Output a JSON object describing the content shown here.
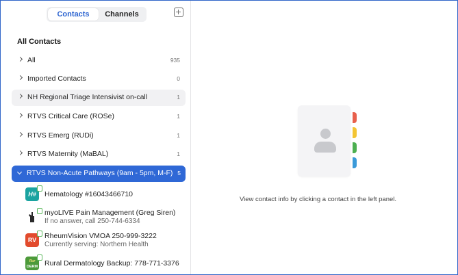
{
  "tabs": {
    "contacts": "Contacts",
    "channels": "Channels"
  },
  "heading": "All Contacts",
  "groups": [
    {
      "label": "All",
      "count": "935"
    },
    {
      "label": "Imported Contacts",
      "count": "0"
    },
    {
      "label": "NH Regional Triage Intensivist on-call",
      "count": "1"
    },
    {
      "label": "RTVS Critical Care (ROSe)",
      "count": "1"
    },
    {
      "label": "RTVS Emerg (RUDi)",
      "count": "1"
    },
    {
      "label": "RTVS Maternity (MaBAL)",
      "count": "1"
    },
    {
      "label": "RTVS Non-Acute Pathways (9am - 5pm, M-F)",
      "count": "5"
    }
  ],
  "contacts": [
    {
      "avatar_text": "H#",
      "name": "Hematology #16043466710",
      "sub": "",
      "avatar_color": "#1aa3a0"
    },
    {
      "avatar_text": "",
      "name": "myoLIVE Pain Management (Greg Siren)",
      "sub": "If no answer, call 250-744-6334",
      "avatar_color": "#2a2a2a"
    },
    {
      "avatar_text": "RV",
      "name": "RheumVision VMOA 250-999-3222",
      "sub": "Currently serving: Northern Health",
      "avatar_color": "#e24b2d"
    },
    {
      "avatar_text": "DERM",
      "avatar_small_text": "Rur",
      "name": "Rural Dermatology Backup: 778-771-3376",
      "sub": "",
      "avatar_color": "#4c9a3a"
    }
  ],
  "empty_hint": "View contact info by clicking a contact in the left panel.",
  "colors": {
    "accent": "#2f68d6",
    "tab_red": "#e8604c",
    "tab_yellow": "#f3c534",
    "tab_green": "#4caf50",
    "tab_blue": "#3a9ad9"
  }
}
